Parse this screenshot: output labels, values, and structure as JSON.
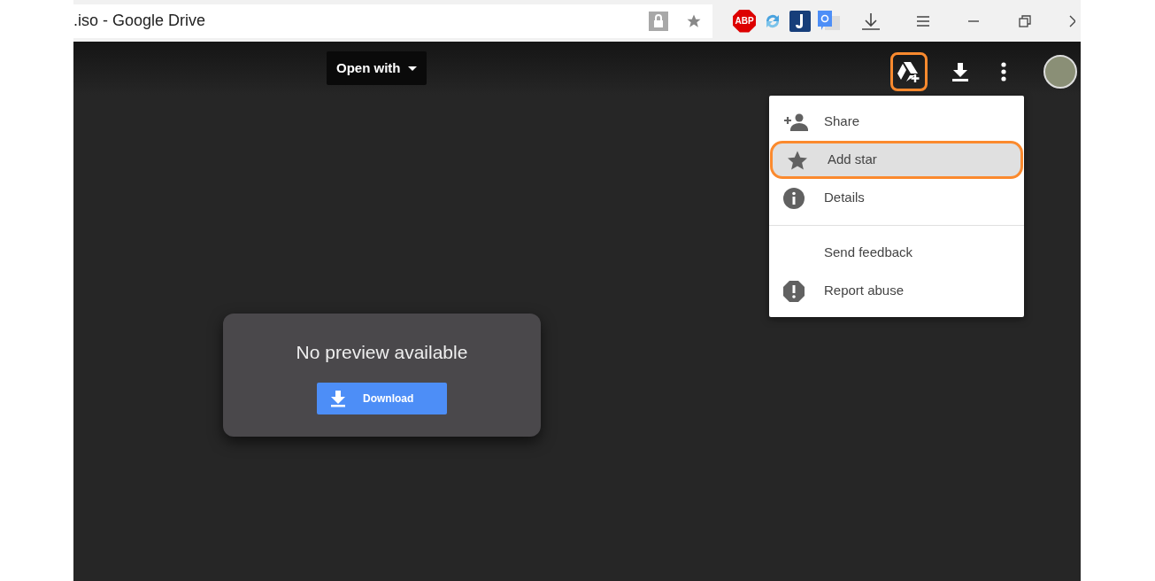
{
  "browser": {
    "tab_title": ".iso - Google Drive",
    "extensions": [
      {
        "kind": "abp",
        "label": "ABP"
      },
      {
        "kind": "sync"
      },
      {
        "kind": "j"
      },
      {
        "kind": "translate"
      }
    ]
  },
  "toolbar": {
    "open_with": "Open with",
    "add_to_drive_highlighted": true
  },
  "menu": {
    "items": [
      {
        "kind": "share",
        "label": "Share",
        "selected": false,
        "highlighted": false,
        "divider_before": false
      },
      {
        "kind": "star",
        "label": "Add star",
        "selected": true,
        "highlighted": true,
        "divider_before": false
      },
      {
        "kind": "info",
        "label": "Details",
        "selected": false,
        "highlighted": false,
        "divider_before": false
      },
      {
        "kind": "text",
        "label": "Send feedback",
        "selected": false,
        "highlighted": false,
        "divider_before": true
      },
      {
        "kind": "report",
        "label": "Report abuse",
        "selected": false,
        "highlighted": false,
        "divider_before": false
      }
    ]
  },
  "preview": {
    "message": "No preview available",
    "button": "Download"
  }
}
